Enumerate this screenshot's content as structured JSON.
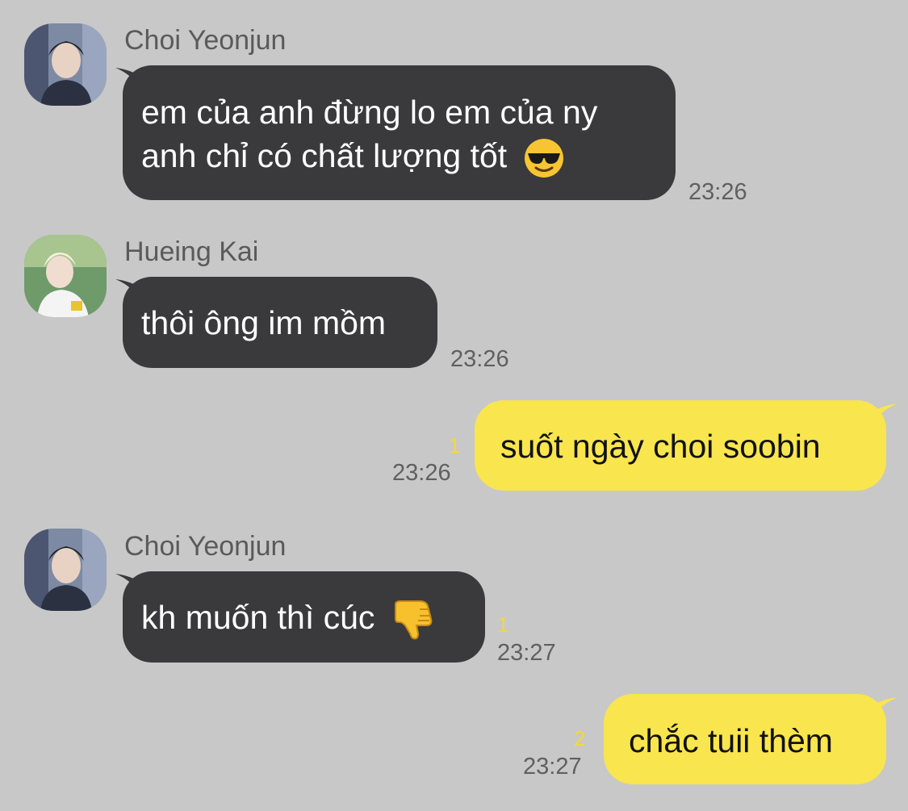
{
  "messages": [
    {
      "sender": "Choi Yeonjun",
      "lines": [
        "em của anh đừng lo em của ny",
        "anh chỉ có chất lượng tốt"
      ],
      "emoji": "sunglasses-smiley-icon",
      "time": "23:26"
    },
    {
      "sender": "Hueing Kai",
      "text": "thôi ông im mồm",
      "time": "23:26"
    },
    {
      "text": "suốt ngày choi soobin",
      "unread": "1",
      "time": "23:26"
    },
    {
      "sender": "Choi Yeonjun",
      "text": "kh muốn thì cúc",
      "emoji": "thumbs-down-icon",
      "unread": "1",
      "time": "23:27"
    },
    {
      "text": "chắc tuii thèm",
      "unread": "2",
      "time": "23:27"
    }
  ],
  "colors": {
    "background": "#c8c8c8",
    "incoming_bubble": "#3a3a3c",
    "outgoing_bubble": "#f9e54d",
    "unread_count": "#f3d83a"
  }
}
